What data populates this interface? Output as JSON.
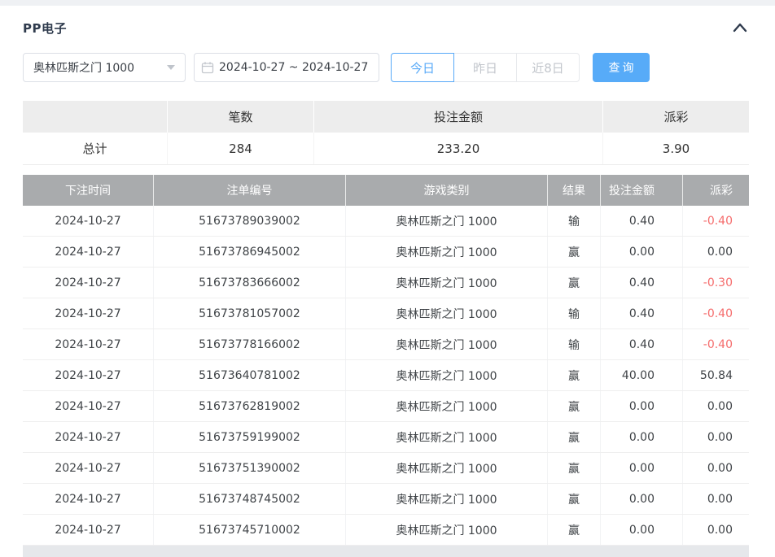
{
  "page": {
    "panel_title": "PP电子"
  },
  "filters": {
    "game_select_value": "奥林匹斯之门 1000",
    "date_range_value": "2024-10-27 ~ 2024-10-27",
    "quick_ranges": [
      {
        "label": "今日",
        "active": true
      },
      {
        "label": "昨日",
        "active": false
      },
      {
        "label": "近8日",
        "active": false
      }
    ],
    "search_label": "查询"
  },
  "summary": {
    "headers": {
      "count": "笔数",
      "bet_amount": "投注金额",
      "payout": "派彩"
    },
    "total_label": "总计",
    "total_count": "284",
    "total_bet_amount": "233.20",
    "total_payout": "3.90"
  },
  "table": {
    "headers": [
      "下注时间",
      "注单编号",
      "游戏类别",
      "结果",
      "投注金额",
      "派彩"
    ],
    "rows": [
      {
        "date": "2024-10-27",
        "order_id": "51673789039002",
        "game": "奥林匹斯之门 1000",
        "result": "输",
        "amount": "0.40",
        "payout": "-0.40"
      },
      {
        "date": "2024-10-27",
        "order_id": "51673786945002",
        "game": "奥林匹斯之门 1000",
        "result": "赢",
        "amount": "0.00",
        "payout": "0.00"
      },
      {
        "date": "2024-10-27",
        "order_id": "51673783666002",
        "game": "奥林匹斯之门 1000",
        "result": "赢",
        "amount": "0.40",
        "payout": "-0.30"
      },
      {
        "date": "2024-10-27",
        "order_id": "51673781057002",
        "game": "奥林匹斯之门 1000",
        "result": "输",
        "amount": "0.40",
        "payout": "-0.40"
      },
      {
        "date": "2024-10-27",
        "order_id": "51673778166002",
        "game": "奥林匹斯之门 1000",
        "result": "输",
        "amount": "0.40",
        "payout": "-0.40"
      },
      {
        "date": "2024-10-27",
        "order_id": "51673640781002",
        "game": "奥林匹斯之门 1000",
        "result": "赢",
        "amount": "40.00",
        "payout": "50.84"
      },
      {
        "date": "2024-10-27",
        "order_id": "51673762819002",
        "game": "奥林匹斯之门 1000",
        "result": "赢",
        "amount": "0.00",
        "payout": "0.00"
      },
      {
        "date": "2024-10-27",
        "order_id": "51673759199002",
        "game": "奥林匹斯之门 1000",
        "result": "赢",
        "amount": "0.00",
        "payout": "0.00"
      },
      {
        "date": "2024-10-27",
        "order_id": "51673751390002",
        "game": "奥林匹斯之门 1000",
        "result": "赢",
        "amount": "0.00",
        "payout": "0.00"
      },
      {
        "date": "2024-10-27",
        "order_id": "51673748745002",
        "game": "奥林匹斯之门 1000",
        "result": "赢",
        "amount": "0.00",
        "payout": "0.00"
      },
      {
        "date": "2024-10-27",
        "order_id": "51673745710002",
        "game": "奥林匹斯之门 1000",
        "result": "赢",
        "amount": "0.00",
        "payout": "0.00"
      }
    ]
  },
  "colors": {
    "accent_blue": "#57a9f8",
    "search_button_bg": "#57abf8",
    "negative_red": "#f56c6c",
    "table_header_bg": "#a9abad",
    "summary_header_bg": "#ededed",
    "title_text": "#2f3b4d"
  }
}
